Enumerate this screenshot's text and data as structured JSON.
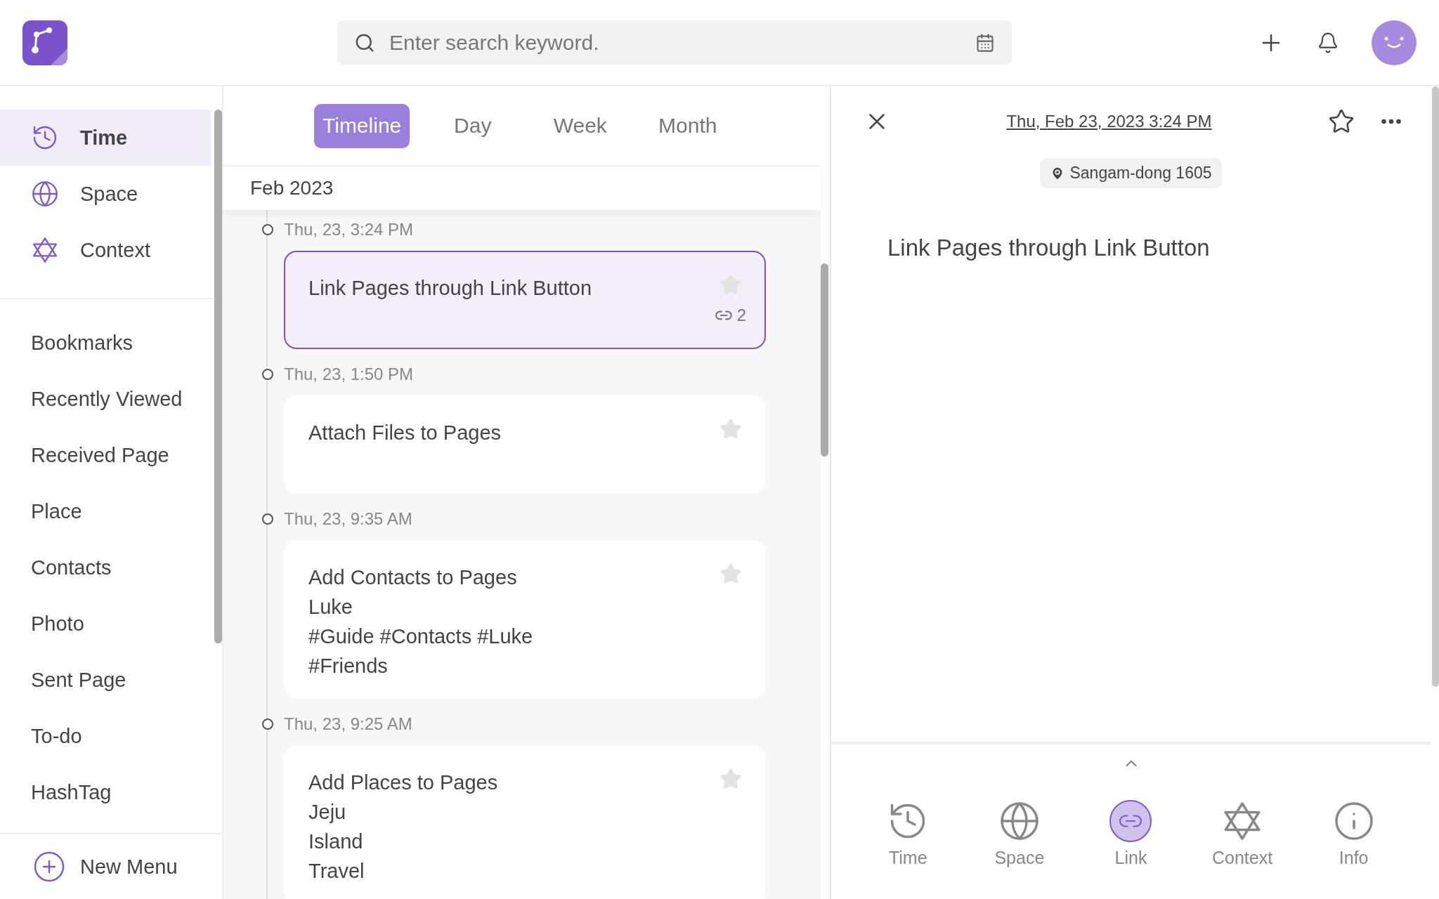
{
  "search": {
    "placeholder": "Enter search keyword."
  },
  "sidebar": {
    "main_items": [
      {
        "label": "Time",
        "kind": "time",
        "selected": true
      },
      {
        "label": "Space",
        "kind": "space",
        "selected": false
      },
      {
        "label": "Context",
        "kind": "context",
        "selected": false
      }
    ],
    "menu_items": [
      "Bookmarks",
      "Recently Viewed",
      "Received Page",
      "Place",
      "Contacts",
      "Photo",
      "Sent Page",
      "To-do",
      "HashTag"
    ],
    "new_menu": "New Menu"
  },
  "view_tabs": [
    {
      "label": "Timeline",
      "selected": true
    },
    {
      "label": "Day",
      "selected": false
    },
    {
      "label": "Week",
      "selected": false
    },
    {
      "label": "Month",
      "selected": false
    }
  ],
  "month": "Feb 2023",
  "entries": [
    {
      "time": "Thu, 23, 3:24 PM",
      "lines": [
        "Link Pages through Link Button"
      ],
      "link_count": "2",
      "selected": true
    },
    {
      "time": "Thu, 23, 1:50 PM",
      "lines": [
        "Attach Files to Pages"
      ],
      "selected": false
    },
    {
      "time": "Thu, 23, 9:35 AM",
      "lines": [
        "Add Contacts to Pages",
        "Luke",
        "#Guide #Contacts #Luke",
        "#Friends"
      ],
      "selected": false
    },
    {
      "time": "Thu, 23, 9:25 AM",
      "lines": [
        "Add Places to Pages",
        "Jeju",
        "Island",
        "Travel"
      ],
      "selected": false
    }
  ],
  "detail": {
    "date": "Thu, Feb 23, 2023 3:24 PM",
    "location": "Sangam-dong 1605",
    "title": "Link Pages through Link Button",
    "nav": [
      {
        "label": "Time",
        "kind": "time",
        "selected": false
      },
      {
        "label": "Space",
        "kind": "space",
        "selected": false
      },
      {
        "label": "Link",
        "kind": "link",
        "selected": true
      },
      {
        "label": "Context",
        "kind": "context",
        "selected": false
      },
      {
        "label": "Info",
        "kind": "info",
        "selected": false
      }
    ]
  }
}
